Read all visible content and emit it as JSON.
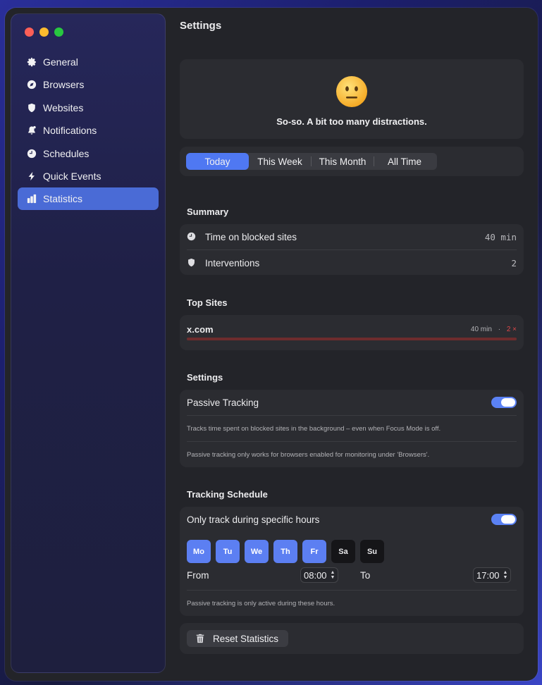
{
  "sidebar": {
    "items": [
      {
        "label": "General",
        "icon": "gear-icon"
      },
      {
        "label": "Browsers",
        "icon": "compass-icon"
      },
      {
        "label": "Websites",
        "icon": "shield-icon"
      },
      {
        "label": "Notifications",
        "icon": "bell-icon"
      },
      {
        "label": "Schedules",
        "icon": "clock-icon"
      },
      {
        "label": "Quick Events",
        "icon": "bolt-icon"
      },
      {
        "label": "Statistics",
        "icon": "chart-icon",
        "active": true
      }
    ]
  },
  "header": {
    "title": "Settings"
  },
  "mood": {
    "emoji": "neutral-face-icon",
    "text": "So-so. A bit too many distractions."
  },
  "range": {
    "options": [
      "Today",
      "This Week",
      "This Month",
      "All Time"
    ],
    "selected": "Today"
  },
  "summary": {
    "title": "Summary",
    "rows": [
      {
        "label": "Time on blocked sites",
        "value": "40 min",
        "icon": "clock-icon"
      },
      {
        "label": "Interventions",
        "value": "2",
        "icon": "shield-icon"
      }
    ]
  },
  "top_sites": {
    "title": "Top Sites",
    "sites": [
      {
        "domain": "x.com",
        "time": "40 min",
        "separator": "·",
        "count": "2 ×",
        "share": 1.0
      }
    ]
  },
  "settings": {
    "title": "Settings",
    "passive_label": "Passive Tracking",
    "passive_on": true,
    "note1": "Tracks time spent on blocked sites in the background – even when Focus Mode is off.",
    "note2": "Passive tracking only works for browsers enabled for monitoring under 'Browsers'."
  },
  "schedule": {
    "title": "Tracking Schedule",
    "only_label": "Only track during specific hours",
    "only_on": true,
    "days": [
      {
        "label": "Mo",
        "on": true
      },
      {
        "label": "Tu",
        "on": true
      },
      {
        "label": "We",
        "on": true
      },
      {
        "label": "Th",
        "on": true
      },
      {
        "label": "Fr",
        "on": true
      },
      {
        "label": "Sa",
        "on": false
      },
      {
        "label": "Su",
        "on": false
      }
    ],
    "from_label": "From",
    "from_value": "08:00",
    "to_label": "To",
    "to_value": "17:00",
    "note": "Passive tracking is only active during these hours."
  },
  "reset": {
    "label": "Reset Statistics"
  },
  "colors": {
    "accent": "#4f78f2",
    "active_nav": "#4a6bd6",
    "danger": "#e0484a"
  }
}
